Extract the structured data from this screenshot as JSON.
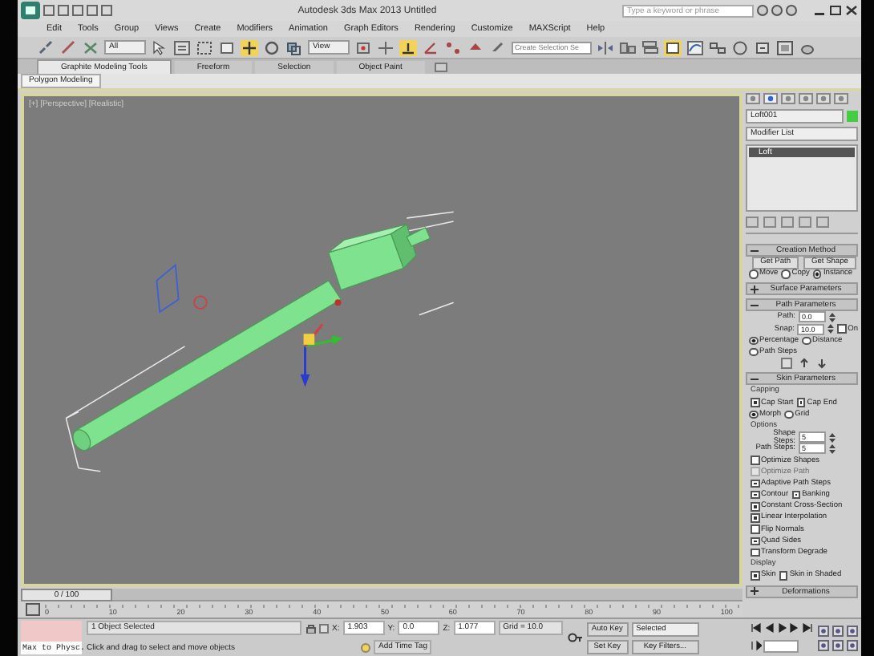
{
  "window": {
    "title": "Autodesk 3ds Max 2013     Untitled"
  },
  "search": {
    "placeholder": "Type a keyword or phrase"
  },
  "menu": [
    "Edit",
    "Tools",
    "Group",
    "Views",
    "Create",
    "Modifiers",
    "Animation",
    "Graph Editors",
    "Rendering",
    "Customize",
    "MAXScript",
    "Help"
  ],
  "toolbar": {
    "selection_filter": "All",
    "reference_coord": "View",
    "selection_set": {
      "placeholder": "Create Selection Se"
    }
  },
  "ribbon": {
    "tabs": [
      {
        "label": "Graphite Modeling Tools",
        "selected": true
      },
      {
        "label": "Freeform",
        "selected": false
      },
      {
        "label": "Selection",
        "selected": false
      },
      {
        "label": "Object Paint",
        "selected": false
      }
    ],
    "panel": "Polygon Modeling"
  },
  "viewport": {
    "label": "[+] [Perspective] [Realistic]"
  },
  "command_panel": {
    "object_name": "Loft001",
    "modifier_list": "Modifier List",
    "stack": [
      {
        "label": "Loft",
        "selected": true
      }
    ],
    "rollouts": [
      {
        "title": "Creation Method",
        "expanded": true,
        "items": [
          {
            "kind": "buttons",
            "labels": [
              "Get Path",
              "Get Shape"
            ]
          },
          {
            "kind": "radios",
            "options": [
              {
                "label": "Move",
                "selected": false
              },
              {
                "label": "Copy",
                "selected": false
              },
              {
                "label": "Instance",
                "selected": true
              }
            ]
          }
        ]
      },
      {
        "title": "Surface Parameters",
        "expanded": false
      },
      {
        "title": "Path Parameters",
        "expanded": true,
        "items": [
          {
            "kind": "spinner",
            "label": "Path:",
            "value": "0.0"
          },
          {
            "kind": "spinner_check",
            "label": "Snap:",
            "value": "10.0",
            "option": {
              "label": "On",
              "checked": false
            }
          },
          {
            "kind": "radios",
            "options": [
              {
                "label": "Percentage",
                "selected": true
              },
              {
                "label": "Distance",
                "selected": false
              }
            ]
          },
          {
            "kind": "radios",
            "options": [
              {
                "label": "Path Steps",
                "selected": false
              }
            ]
          },
          {
            "kind": "icon_row"
          }
        ]
      },
      {
        "title": "Skin Parameters",
        "expanded": true,
        "items": [
          {
            "kind": "group",
            "title": "Capping"
          },
          {
            "kind": "checks",
            "options": [
              {
                "label": "Cap Start",
                "checked": true,
                "disabled": false
              },
              {
                "label": "Cap End",
                "checked": true,
                "disabled": false
              }
            ]
          },
          {
            "kind": "radios",
            "options": [
              {
                "label": "Morph",
                "selected": true
              },
              {
                "label": "Grid",
                "selected": false
              }
            ]
          },
          {
            "kind": "group",
            "title": "Options"
          },
          {
            "kind": "spinner",
            "label": "Shape Steps:",
            "value": "5"
          },
          {
            "kind": "spinner",
            "label": "Path Steps:",
            "value": "5"
          },
          {
            "kind": "checks",
            "options": [
              {
                "label": "Optimize Shapes",
                "checked": false,
                "disabled": false
              }
            ]
          },
          {
            "kind": "checks",
            "options": [
              {
                "label": "Optimize Path",
                "checked": false,
                "disabled": true
              }
            ]
          },
          {
            "kind": "checks",
            "options": [
              {
                "label": "Adaptive Path Steps",
                "checked": true,
                "disabled": false
              }
            ]
          },
          {
            "kind": "checks",
            "options": [
              {
                "label": "Contour",
                "checked": true,
                "disabled": false
              },
              {
                "label": "Banking",
                "checked": true,
                "disabled": false
              }
            ]
          },
          {
            "kind": "checks",
            "options": [
              {
                "label": "Constant Cross-Section",
                "checked": true,
                "disabled": false
              }
            ]
          },
          {
            "kind": "checks",
            "options": [
              {
                "label": "Linear Interpolation",
                "checked": true,
                "disabled": false
              }
            ]
          },
          {
            "kind": "checks",
            "options": [
              {
                "label": "Flip Normals",
                "checked": false,
                "disabled": false
              }
            ]
          },
          {
            "kind": "checks",
            "options": [
              {
                "label": "Quad Sides",
                "checked": true,
                "disabled": false
              }
            ]
          },
          {
            "kind": "checks",
            "options": [
              {
                "label": "Transform Degrade",
                "checked": false,
                "disabled": false
              }
            ]
          },
          {
            "kind": "group",
            "title": "Display"
          },
          {
            "kind": "checks",
            "options": [
              {
                "label": "Skin",
                "checked": true,
                "disabled": false
              },
              {
                "label": "Skin in Shaded",
                "checked": false,
                "disabled": false
              }
            ]
          }
        ]
      },
      {
        "title": "Deformations",
        "expanded": false
      }
    ]
  },
  "time_slider": {
    "label": "0 / 100",
    "level": 0
  },
  "timeline_ticks": [
    "0",
    "10",
    "20",
    "30",
    "40",
    "50",
    "60",
    "70",
    "80",
    "90",
    "100"
  ],
  "status_bar": {
    "listener": "Max to Physc.",
    "selection": "1 Object Selected",
    "prompt": "Click and drag to select and move objects",
    "coords": [
      {
        "axis": "X:",
        "value": "1.903"
      },
      {
        "axis": "Y:",
        "value": "0.0"
      },
      {
        "axis": "Z:",
        "value": "1.077"
      }
    ],
    "grid": "Grid = 10.0",
    "time_tag": "Add Time Tag",
    "auto_key": "Auto Key",
    "key_mode": "Selected",
    "set_key": "Set Key",
    "key_filters": "Key Filters..."
  }
}
